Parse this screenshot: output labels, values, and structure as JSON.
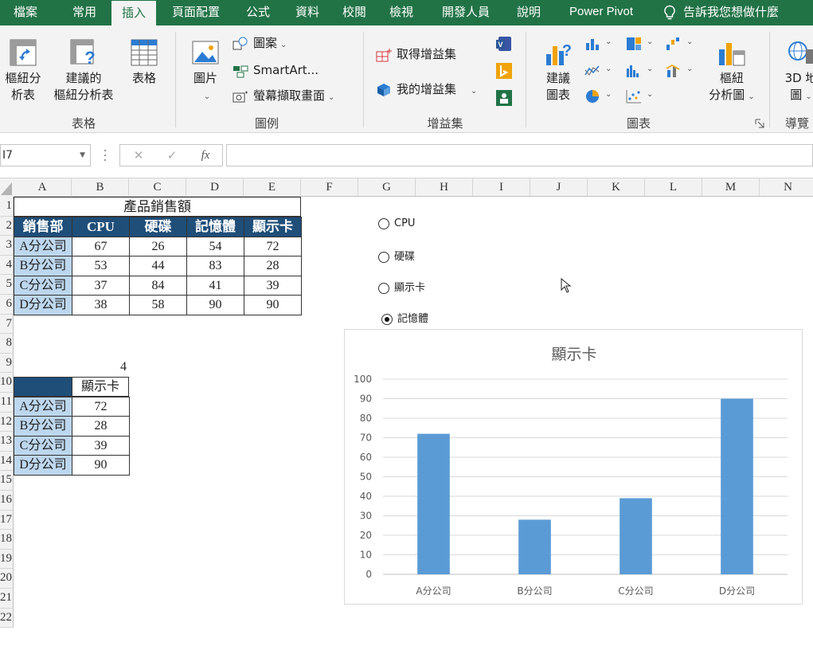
{
  "tabs": [
    {
      "label": "檔案",
      "active": false
    },
    {
      "label": "常用",
      "active": false
    },
    {
      "label": "插入",
      "active": true
    },
    {
      "label": "頁面配置",
      "active": false
    },
    {
      "label": "公式",
      "active": false
    },
    {
      "label": "資料",
      "active": false
    },
    {
      "label": "校閱",
      "active": false
    },
    {
      "label": "檢視",
      "active": false
    },
    {
      "label": "開發人員",
      "active": false
    },
    {
      "label": "說明",
      "active": false
    },
    {
      "label": "Power Pivot",
      "active": false
    }
  ],
  "tell_me": "告訴我您想做什麼",
  "ribbon": {
    "tables_group": {
      "pivot_line1": "樞紐分",
      "pivot_line2": "析表",
      "recommended_line1": "建議的",
      "recommended_line2": "樞紐分析表",
      "table": "表格",
      "label": "表格"
    },
    "illustrations_group": {
      "pictures": "圖片",
      "shapes": "圖案",
      "smartart": "SmartArt...",
      "screenshot": "螢幕擷取畫面",
      "label": "圖例"
    },
    "addins_group": {
      "get_addins": "取得增益集",
      "my_addins": "我的增益集",
      "label": "增益集"
    },
    "charts_group": {
      "recommended_line1": "建議",
      "recommended_line2": "圖表",
      "pivotchart_line1": "樞紐",
      "pivotchart_line2": "分析圖",
      "label": "圖表"
    },
    "tours_group": {
      "map_line1": "3D 地",
      "map_line2": "圖",
      "label": "導覽"
    }
  },
  "formula_bar": {
    "name_box": "I7",
    "cancel": "✕",
    "enter": "✓",
    "fx": "fx",
    "formula": ""
  },
  "columns": [
    "A",
    "B",
    "C",
    "D",
    "E",
    "F",
    "G",
    "H",
    "I",
    "J",
    "K",
    "L",
    "M",
    "N"
  ],
  "rows": [
    "1",
    "2",
    "3",
    "4",
    "5",
    "6",
    "7",
    "8",
    "9",
    "10",
    "11",
    "12",
    "13",
    "14",
    "15",
    "16",
    "17",
    "18",
    "19",
    "20",
    "21",
    "22"
  ],
  "sales_table": {
    "title": "產品銷售額",
    "headers": [
      "銷售部",
      "CPU",
      "硬碟",
      "記憶體",
      "顯示卡"
    ],
    "rows": [
      [
        "A分公司",
        "67",
        "26",
        "54",
        "72"
      ],
      [
        "B分公司",
        "53",
        "44",
        "83",
        "28"
      ],
      [
        "C分公司",
        "37",
        "84",
        "41",
        "39"
      ],
      [
        "D分公司",
        "38",
        "58",
        "90",
        "90"
      ]
    ]
  },
  "selected_index": "4",
  "sub_table": {
    "header": "顯示卡",
    "rows": [
      [
        "A分公司",
        "72"
      ],
      [
        "B分公司",
        "28"
      ],
      [
        "C分公司",
        "39"
      ],
      [
        "D分公司",
        "90"
      ]
    ]
  },
  "radio_options": [
    {
      "label": "CPU",
      "selected": false
    },
    {
      "label": "硬碟",
      "selected": false
    },
    {
      "label": "顯示卡",
      "selected": false
    },
    {
      "label": "記憶體",
      "selected": true
    }
  ],
  "colors": {
    "accent": "#217346",
    "header_dark": "#1f4e79",
    "header_light": "#bdd7ee",
    "bar": "#5b9bd5"
  },
  "chart_data": {
    "type": "bar",
    "title": "顯示卡",
    "categories": [
      "A分公司",
      "B分公司",
      "C分公司",
      "D分公司"
    ],
    "values": [
      72,
      28,
      39,
      90
    ],
    "ylim": [
      0,
      100
    ],
    "yticks": [
      0,
      10,
      20,
      30,
      40,
      50,
      60,
      70,
      80,
      90,
      100
    ],
    "grid": true,
    "legend": "none"
  }
}
